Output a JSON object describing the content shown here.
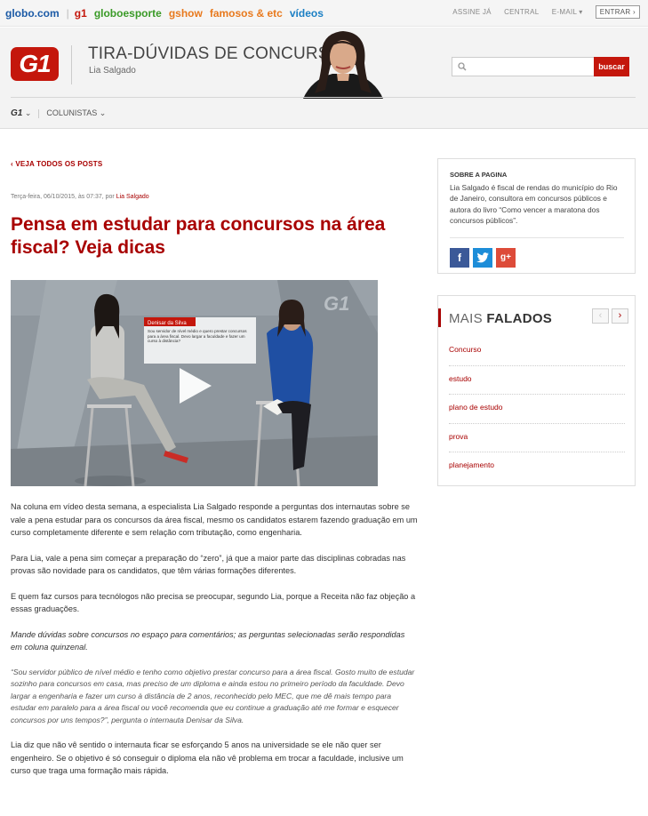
{
  "globobar": {
    "links": [
      "globo.com",
      "g1",
      "globoesporte",
      "gshow",
      "famosos & etc",
      "vídeos"
    ],
    "right": [
      "ASSINE JÁ",
      "CENTRAL",
      "E-MAIL",
      "ENTRAR"
    ]
  },
  "header": {
    "logo": "G1",
    "column_title": "TIRA-DÚVIDAS DE CONCURSOS",
    "author": "Lia Salgado",
    "search_button": "buscar",
    "subnav": [
      "G1",
      "COLUNISTAS"
    ]
  },
  "article": {
    "back_link": "VEJA TODOS OS POSTS",
    "date": "Terça-feira, 06/10/2015, às 07:37, por",
    "author": "Lia Salgado",
    "headline": "Pensa em estudar para concursos na área fiscal? Veja dicas",
    "video_caption": {
      "name": "Denisar da Silva",
      "text": "Sou servidor de nível médio e quero prestar concursos para a área fiscal. Devo largar a faculdade e fazer um curso à distância?"
    },
    "paragraphs": [
      "Na coluna em vídeo desta semana, a especialista Lia Salgado responde a perguntas dos internautas sobre se vale a pena estudar para os concursos da área fiscal, mesmo os candidatos estarem fazendo graduação em um curso completamente diferente e sem relação com tributação, como engenharia.",
      "Para Lia, vale a pena sim começar a preparação do “zero”, já que a maior parte das disciplinas cobradas nas provas são novidade para os candidatos, que têm várias formações diferentes.",
      "E quem faz cursos para tecnólogos não precisa se preocupar, segundo Lia, porque a Receita não faz objeção a essas graduações.",
      "Mande dúvidas sobre concursos no espaço para comentários; as perguntas selecionadas serão respondidas em coluna quinzenal.",
      "“Sou servidor público de nível médio e tenho como objetivo prestar concurso para a área fiscal. Gosto muito de estudar sozinho para concursos em casa, mas preciso de um diploma e ainda estou no primeiro período da faculdade. Devo largar a engenharia e fazer um curso à distância de 2 anos, reconhecido pelo MEC, que me dê mais tempo para estudar em paralelo para a área fiscal ou você recomenda que eu continue a graduação até me formar e esquecer concursos por uns tempos?”, pergunta o internauta Denisar da Silva.",
      "Lia diz que não vê sentido o internauta ficar se esforçando 5 anos na universidade se ele não quer ser engenheiro. Se o objetivo é só conseguir o diploma ela não vê problema em trocar a faculdade, inclusive um curso que traga uma formação mais rápida."
    ]
  },
  "sidebar": {
    "about_title": "SOBRE A PAGINA",
    "about_text": "Lia Salgado é fiscal de rendas do município do Rio de Janeiro, consultora em concursos públicos e autora do livro “Como vencer a maratona dos concursos públicos”.",
    "social": [
      "f",
      "t",
      "g+"
    ],
    "popular_title_light": "MAIS ",
    "popular_title_bold": "FALADOS",
    "popular_items": [
      "Concurso",
      "estudo",
      "plano de estudo",
      "prova",
      "planejamento"
    ]
  }
}
